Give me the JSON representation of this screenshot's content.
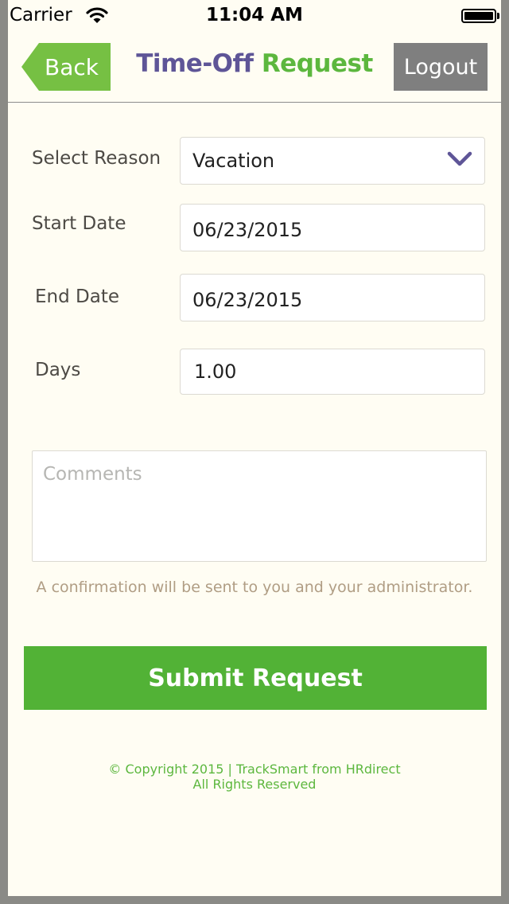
{
  "status_bar": {
    "carrier": "Carrier",
    "time": "11:04 AM"
  },
  "nav": {
    "back_label": "Back",
    "title_part1": "Time-Off",
    "title_part2": "Request",
    "logout_label": "Logout"
  },
  "form": {
    "reason_label": "Select Reason",
    "reason_value": "Vacation",
    "start_label": "Start Date",
    "start_value": "06/23/2015",
    "end_label": "End Date",
    "end_value": "06/23/2015",
    "days_label": "Days",
    "days_value": "1.00",
    "comments_placeholder": "Comments",
    "confirmation_note": "A confirmation will be sent to you and your administrator."
  },
  "submit_label": "Submit Request",
  "footer": {
    "line1": "© Copyright 2015 | TrackSmart from HRdirect",
    "line2": "All Rights Reserved"
  },
  "colors": {
    "accent_green": "#52b236",
    "title_purple": "#5e5597",
    "back_green": "#76c043",
    "logout_gray": "#7f7f7f"
  },
  "icons": {
    "wifi": "wifi-icon",
    "battery": "battery-icon",
    "dropdown": "chevron-down-icon"
  }
}
